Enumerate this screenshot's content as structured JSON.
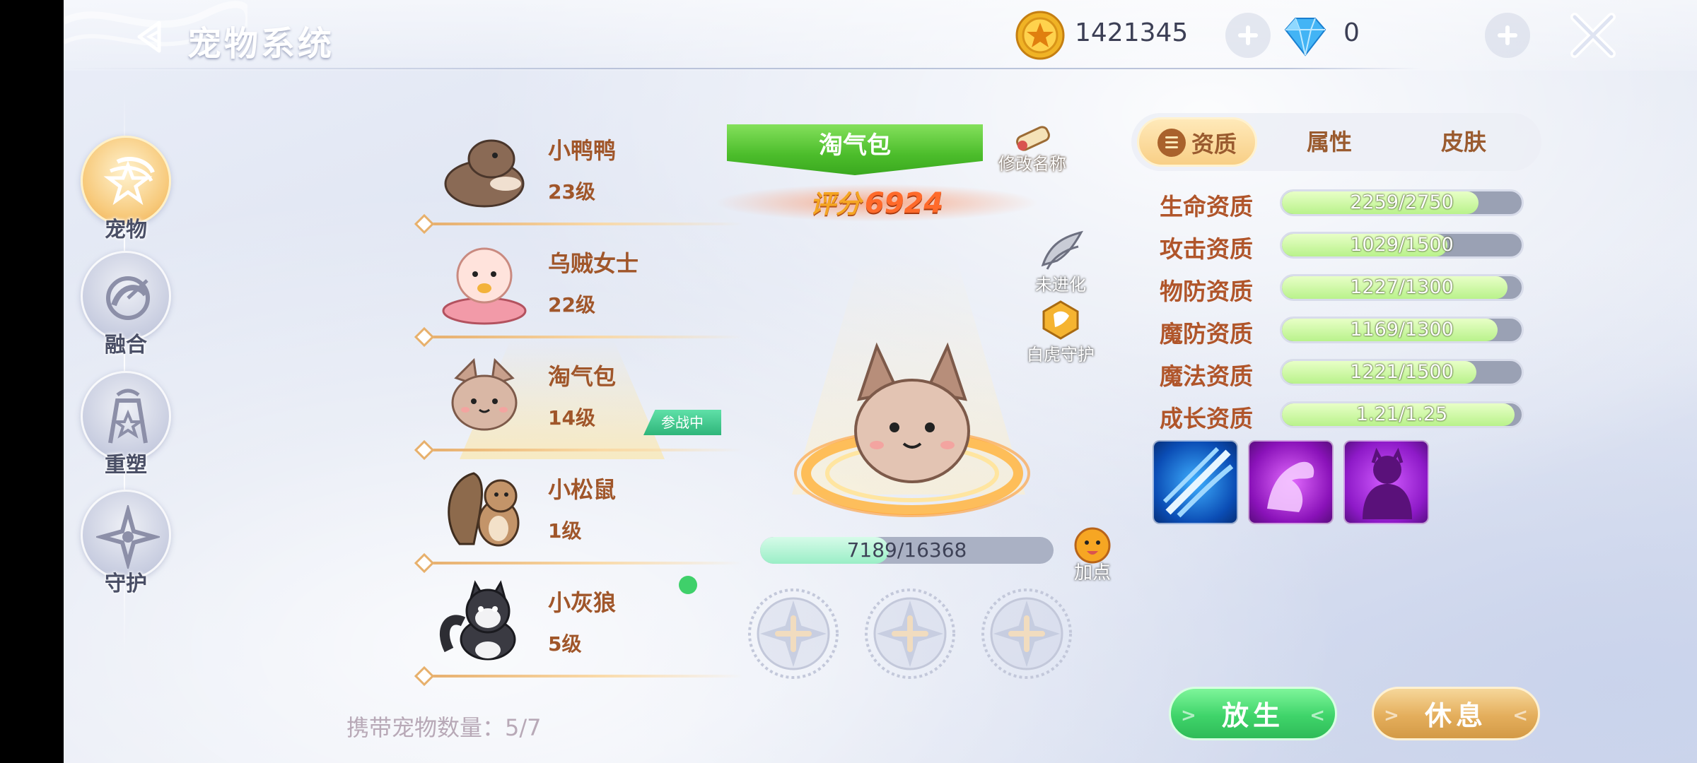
{
  "header": {
    "title": "宠物系统",
    "gold": "1421345",
    "gems": "0"
  },
  "nav": [
    {
      "label": "宠物",
      "icon": "pet-icon",
      "active": true
    },
    {
      "label": "融合",
      "icon": "fusion-icon",
      "active": false
    },
    {
      "label": "重塑",
      "icon": "reshape-icon",
      "active": false
    },
    {
      "label": "守护",
      "icon": "guard-icon",
      "active": false
    }
  ],
  "pets": [
    {
      "name": "小鸭鸭",
      "level": "23级"
    },
    {
      "name": "乌贼女士",
      "level": "22级"
    },
    {
      "name": "淘气包",
      "level": "14级",
      "badge": "参战中",
      "selected": true
    },
    {
      "name": "小松鼠",
      "level": "1级"
    },
    {
      "name": "小灰狼",
      "level": "5级"
    }
  ],
  "carry_count": "携带宠物数量：5/7",
  "selected_pet": {
    "name": "淘气包",
    "rename_label": "修改名称",
    "score_label": "评分",
    "score_value": "6924",
    "evolve_label": "未进化",
    "guardian_label": "白虎守护",
    "exp_text": "7189/16368",
    "exp_fraction": 0.439,
    "add_point_label": "加点"
  },
  "tabs": [
    {
      "label": "资质",
      "active": true
    },
    {
      "label": "属性",
      "active": false
    },
    {
      "label": "皮肤",
      "active": false
    }
  ],
  "stats": [
    {
      "label": "生命资质",
      "text": "2259/2750",
      "fraction": 0.82
    },
    {
      "label": "攻击资质",
      "text": "1029/1500",
      "fraction": 0.69
    },
    {
      "label": "物防资质",
      "text": "1227/1300",
      "fraction": 0.94
    },
    {
      "label": "魔防资质",
      "text": "1169/1300",
      "fraction": 0.9
    },
    {
      "label": "魔法资质",
      "text": "1221/1500",
      "fraction": 0.81
    },
    {
      "label": "成长资质",
      "text": "1.21/1.25",
      "fraction": 0.97
    }
  ],
  "skills": [
    {
      "icon": "claw-slash-icon"
    },
    {
      "icon": "muscle-power-icon"
    },
    {
      "icon": "shadow-figure-icon"
    }
  ],
  "actions": {
    "release": "放生",
    "rest": "休息"
  },
  "colors": {
    "stat_label": "#b0552a",
    "pet_text": "#a0562a",
    "release_green": "#3fd46a",
    "rest_gold": "#e4ae5c",
    "name_banner_green": "#4cbd2b"
  }
}
